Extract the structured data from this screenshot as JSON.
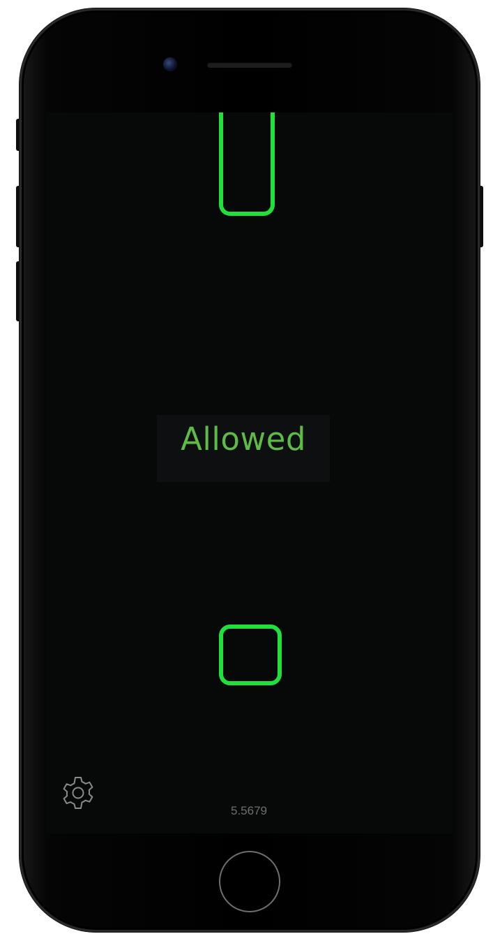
{
  "screen": {
    "status_text": "Allowed",
    "readout_value": "5.5679"
  },
  "icons": {
    "settings": "gear-icon",
    "home": "home-button"
  },
  "colors": {
    "screen_background": "#070808",
    "shape_stroke": "#22e03a",
    "status_text": "#5dbb46",
    "readout_text": "#6e6e6e"
  }
}
